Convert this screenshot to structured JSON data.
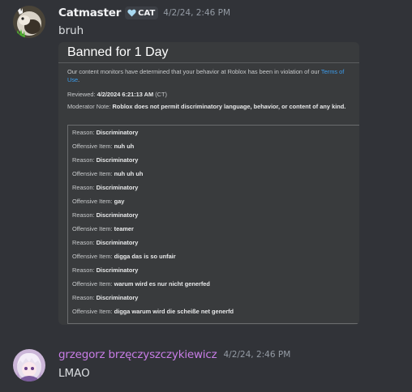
{
  "messages": [
    {
      "username": "Catmaster",
      "username_color": "#f2f3f5",
      "tag": {
        "icon": "heart-icon",
        "label": "CAT"
      },
      "timestamp": "4/2/24, 2:46 PM",
      "text": "bruh",
      "avatar_icon": "cat-avatar-icon"
    },
    {
      "username": "grzegorz brzęczyszczykiewicz",
      "username_color": "#c87de6",
      "timestamp": "4/2/24, 2:46 PM",
      "text": "LMAO",
      "avatar_icon": "anime-avatar-icon"
    }
  ],
  "attachment": {
    "title": "Banned for 1 Day",
    "description_prefix": "Our content monitors have determined that your behavior at Roblox has been in violation of our ",
    "description_link": "Terms of Use",
    "description_suffix": ".",
    "reviewed_label": "Reviewed:",
    "reviewed_value": "4/2/2024 6:21:13 AM",
    "reviewed_tz": "(CT)",
    "note_label": "Moderator Note:",
    "note_value": "Roblox does not permit discriminatory language, behavior, or content of any kind.",
    "rows": [
      {
        "label": "Reason:",
        "value": "Discriminatory"
      },
      {
        "label": "Offensive Item:",
        "value": "nuh uh"
      },
      {
        "label": "Reason:",
        "value": "Discriminatory"
      },
      {
        "label": "Offensive Item:",
        "value": "nuh uh uh"
      },
      {
        "label": "Reason:",
        "value": "Discriminatory"
      },
      {
        "label": "Offensive Item:",
        "value": "gay"
      },
      {
        "label": "Reason:",
        "value": "Discriminatory"
      },
      {
        "label": "Offensive Item:",
        "value": "teamer"
      },
      {
        "label": "Reason:",
        "value": "Discriminatory"
      },
      {
        "label": "Offensive Item:",
        "value": "digga das is so unfair"
      },
      {
        "label": "Reason:",
        "value": "Discriminatory"
      },
      {
        "label": "Offensive Item:",
        "value": "warum wird es nur nicht generfed"
      },
      {
        "label": "Reason:",
        "value": "Discriminatory"
      },
      {
        "label": "Offensive Item:",
        "value": "digga warum wird die scheiße net generfd"
      }
    ]
  },
  "colors": {
    "background": "#313338",
    "link": "#3b9ded",
    "timestamp": "#949ba4"
  }
}
